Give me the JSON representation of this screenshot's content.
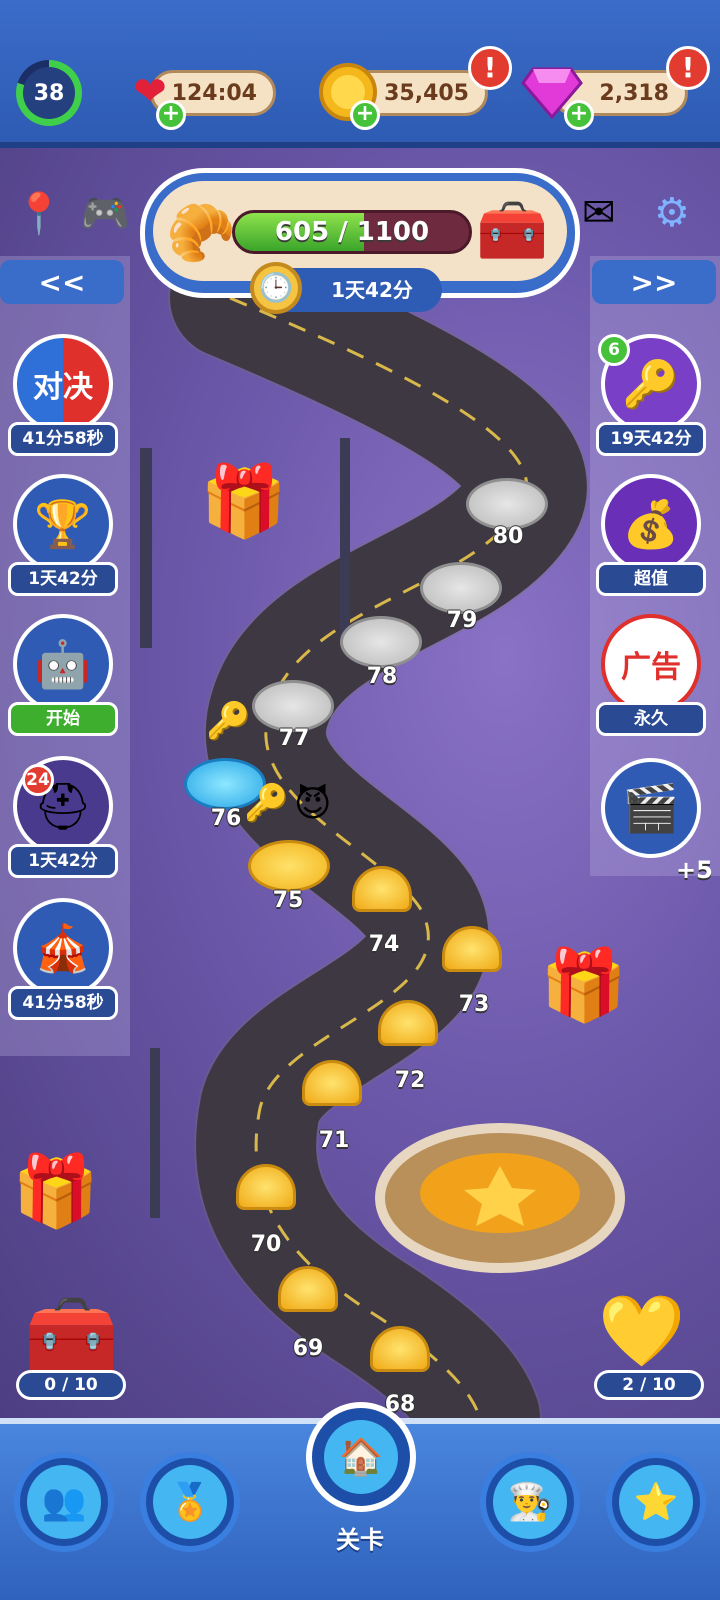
{
  "top": {
    "level": "38",
    "lives": "124:04",
    "coins": "35,405",
    "gems": "2,318",
    "alert_symbol": "!",
    "plus_symbol": "+"
  },
  "progress": {
    "text": "605 / 1100",
    "current": 605,
    "max": 1100,
    "timer": "1天42分"
  },
  "nav_arrows": {
    "left": "<<",
    "right": ">>"
  },
  "left_events": [
    {
      "label": "41分58秒",
      "icon": "versus-icon",
      "glyph": "对决"
    },
    {
      "label": "1天42分",
      "icon": "trophy-icon",
      "glyph": "🏆"
    },
    {
      "label": "开始",
      "icon": "robot-pot-icon",
      "glyph": "🤖"
    },
    {
      "label": "1天42分",
      "icon": "helmet-icon",
      "glyph": "⛑",
      "badge": "24"
    },
    {
      "label": "41分58秒",
      "icon": "shop-tent-icon",
      "glyph": "🎪"
    }
  ],
  "right_events": [
    {
      "label": "19天42分",
      "icon": "key-icon",
      "glyph": "🔑",
      "badge": "6"
    },
    {
      "label": "超值",
      "icon": "treasure-icon",
      "glyph": "💰"
    },
    {
      "label": "永久",
      "icon": "no-ads-icon",
      "glyph": "广告"
    },
    {
      "label": "+5",
      "icon": "video-gem-icon",
      "glyph": "🎬"
    }
  ],
  "levels": [
    "80",
    "79",
    "78",
    "77",
    "76",
    "75",
    "74",
    "73",
    "72",
    "71",
    "70",
    "69",
    "68"
  ],
  "chests": {
    "left": "0 / 10",
    "right": "2 / 10"
  },
  "bottom_nav": {
    "active_label": "关卡"
  },
  "colors": {
    "accent_blue": "#3a6cc9",
    "gold": "#f2b21a",
    "green": "#46c23a"
  }
}
